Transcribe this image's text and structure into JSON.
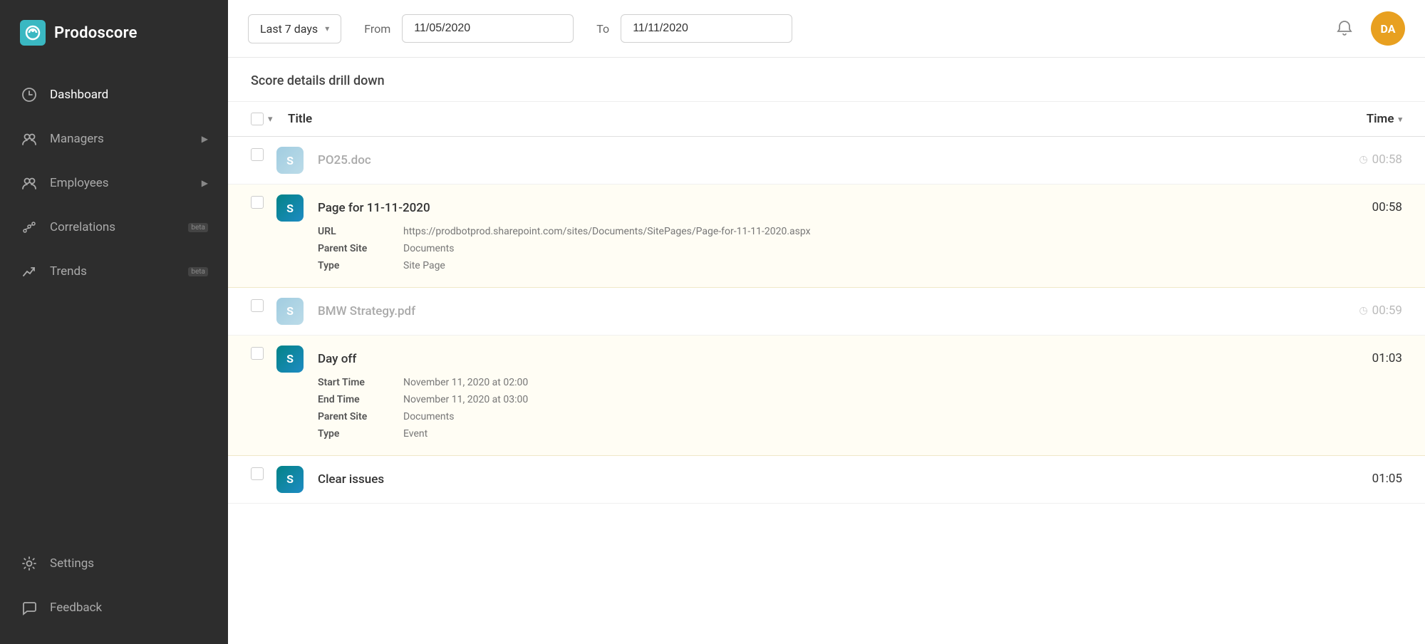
{
  "app": {
    "name": "Prodoscore"
  },
  "header": {
    "date_range_label": "Last 7 days",
    "from_label": "From",
    "from_value": "11/05/2020",
    "to_label": "To",
    "to_value": "11/11/2020",
    "avatar_initials": "DA"
  },
  "sidebar": {
    "items": [
      {
        "id": "dashboard",
        "label": "Dashboard",
        "icon": "dashboard"
      },
      {
        "id": "managers",
        "label": "Managers",
        "icon": "managers",
        "has_arrow": true
      },
      {
        "id": "employees",
        "label": "Employees",
        "icon": "employees",
        "has_arrow": true
      },
      {
        "id": "correlations",
        "label": "Correlations",
        "icon": "correlations",
        "badge": "beta"
      },
      {
        "id": "trends",
        "label": "Trends",
        "icon": "trends",
        "badge": "beta"
      }
    ],
    "bottom_items": [
      {
        "id": "settings",
        "label": "Settings",
        "icon": "settings"
      },
      {
        "id": "feedback",
        "label": "Feedback",
        "icon": "feedback"
      }
    ]
  },
  "drill_down": {
    "title": "Score details drill down",
    "columns": {
      "title": "Title",
      "time": "Time"
    },
    "sort_col": "Time",
    "rows": [
      {
        "id": "row1",
        "title": "PO25.doc",
        "time": "00:58",
        "dimmed": true,
        "expanded": false,
        "icon_type": "sp-light"
      },
      {
        "id": "row2",
        "title": "Page for 11-11-2020",
        "time": "00:58",
        "dimmed": false,
        "expanded": true,
        "icon_type": "sp",
        "details": [
          {
            "label": "URL",
            "value": "https://prodbotprod.sharepoint.com/sites/Documents/SitePages/Page-for-11-11-2020.aspx"
          },
          {
            "label": "Parent Site",
            "value": "Documents"
          },
          {
            "label": "Type",
            "value": "Site Page"
          }
        ]
      },
      {
        "id": "row3",
        "title": "BMW Strategy.pdf",
        "time": "00:59",
        "dimmed": true,
        "expanded": false,
        "icon_type": "sp-light"
      },
      {
        "id": "row4",
        "title": "Day off",
        "time": "01:03",
        "dimmed": false,
        "expanded": true,
        "icon_type": "sp",
        "details": [
          {
            "label": "Start Time",
            "value": "November 11, 2020 at 02:00"
          },
          {
            "label": "End Time",
            "value": "November 11, 2020 at 03:00"
          },
          {
            "label": "Parent Site",
            "value": "Documents"
          },
          {
            "label": "Type",
            "value": "Event"
          }
        ]
      },
      {
        "id": "row5",
        "title": "Clear issues",
        "time": "01:05",
        "dimmed": false,
        "expanded": false,
        "icon_type": "sp"
      }
    ]
  }
}
